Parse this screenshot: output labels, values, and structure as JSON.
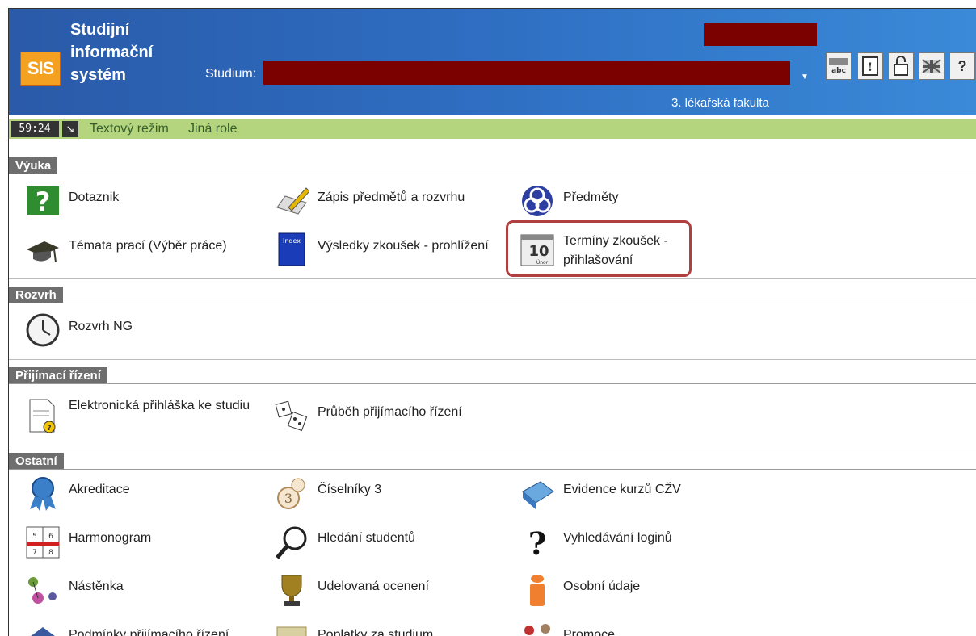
{
  "header": {
    "app_title_lines": [
      "Studijní",
      "informační",
      "systém"
    ],
    "logo_text": "SIS",
    "studium_label": "Studium:",
    "faculty": "3. lékařská fakulta",
    "icons": [
      "abc-dictionary-icon",
      "help-document-icon",
      "lock-icon",
      "uk-flag-icon",
      "question-icon"
    ]
  },
  "status": {
    "timer": "59:24",
    "links": [
      "Textový režim",
      "Jiná role"
    ]
  },
  "sections": {
    "vyuka": {
      "title": "Výuka",
      "items": [
        {
          "label": "Dotaznik",
          "icon": "questionnaire-icon"
        },
        {
          "label": "Zápis předmětů a rozvrhu",
          "icon": "pencil-enrollment-icon"
        },
        {
          "label": "Předměty",
          "icon": "celtic-knot-icon"
        },
        {
          "label": "Témata prací (Výběr práce)",
          "icon": "graduation-cap-icon"
        },
        {
          "label": "Výsledky zkoušek - prohlížení",
          "icon": "index-book-icon"
        },
        {
          "label": "Termíny zkoušek - přihlašování",
          "icon": "calendar-icon"
        }
      ]
    },
    "rozvrh": {
      "title": "Rozvrh",
      "items": [
        {
          "label": "Rozvrh NG",
          "icon": "clock-icon"
        }
      ]
    },
    "prijimaci": {
      "title": "Přijímací řízení",
      "items": [
        {
          "label": "Elektronická přihláška ke studiu",
          "icon": "application-form-icon"
        },
        {
          "label": "Průběh přijímacího řízení",
          "icon": "dice-icon"
        }
      ]
    },
    "ostatni": {
      "title": "Ostatní",
      "items": [
        {
          "label": "Akreditace",
          "icon": "ribbon-award-icon"
        },
        {
          "label": "Číselníky 3",
          "icon": "numbers-icon"
        },
        {
          "label": "Evidence kurzů CŽV",
          "icon": "book-register-icon"
        },
        {
          "label": "Harmonogram",
          "icon": "calendar-grid-icon"
        },
        {
          "label": "Hledání studentů",
          "icon": "magnifier-icon"
        },
        {
          "label": "Vyhledávání loginů",
          "icon": "question-mark-icon"
        },
        {
          "label": "Nástěnka",
          "icon": "pins-icon"
        },
        {
          "label": "Udelovaná ocenení",
          "icon": "trophy-icon"
        },
        {
          "label": "Osobní údaje",
          "icon": "person-icon"
        },
        {
          "label": "Podmínky přijímacího řízení",
          "icon": "conditions-icon"
        },
        {
          "label": "Poplatky za studium",
          "icon": "fees-icon"
        },
        {
          "label": "Promoce",
          "icon": "graduation-icon"
        }
      ]
    }
  }
}
